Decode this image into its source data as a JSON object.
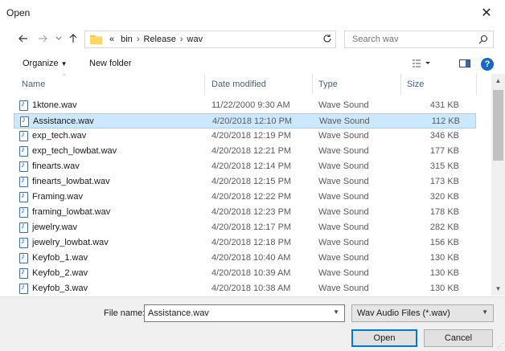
{
  "window": {
    "title": "Open",
    "close_glyph": "✕"
  },
  "nav": {
    "path": [
      "«",
      "bin",
      "Release",
      "wav"
    ],
    "search_placeholder": "Search wav"
  },
  "toolbar": {
    "organize": "Organize",
    "new_folder": "New folder"
  },
  "columns": {
    "name": "Name",
    "date": "Date modified",
    "type": "Type",
    "size": "Size"
  },
  "files": [
    {
      "name": "1ktone.wav",
      "date": "11/22/2000 9:30 AM",
      "type": "Wave Sound",
      "size": "431 KB",
      "selected": false
    },
    {
      "name": "Assistance.wav",
      "date": "4/20/2018 12:10 PM",
      "type": "Wave Sound",
      "size": "112 KB",
      "selected": true
    },
    {
      "name": "exp_tech.wav",
      "date": "4/20/2018 12:19 PM",
      "type": "Wave Sound",
      "size": "346 KB",
      "selected": false
    },
    {
      "name": "exp_tech_lowbat.wav",
      "date": "4/20/2018 12:21 PM",
      "type": "Wave Sound",
      "size": "177 KB",
      "selected": false
    },
    {
      "name": "finearts.wav",
      "date": "4/20/2018 12:14 PM",
      "type": "Wave Sound",
      "size": "315 KB",
      "selected": false
    },
    {
      "name": "finearts_lowbat.wav",
      "date": "4/20/2018 12:15 PM",
      "type": "Wave Sound",
      "size": "173 KB",
      "selected": false
    },
    {
      "name": "Framing.wav",
      "date": "4/20/2018 12:22 PM",
      "type": "Wave Sound",
      "size": "320 KB",
      "selected": false
    },
    {
      "name": "framing_lowbat.wav",
      "date": "4/20/2018 12:23 PM",
      "type": "Wave Sound",
      "size": "178 KB",
      "selected": false
    },
    {
      "name": "jewelry.wav",
      "date": "4/20/2018 12:17 PM",
      "type": "Wave Sound",
      "size": "282 KB",
      "selected": false
    },
    {
      "name": "jewelry_lowbat.wav",
      "date": "4/20/2018 12:18 PM",
      "type": "Wave Sound",
      "size": "156 KB",
      "selected": false
    },
    {
      "name": "Keyfob_1.wav",
      "date": "4/20/2018 10:40 AM",
      "type": "Wave Sound",
      "size": "130 KB",
      "selected": false
    },
    {
      "name": "Keyfob_2.wav",
      "date": "4/20/2018 10:39 AM",
      "type": "Wave Sound",
      "size": "130 KB",
      "selected": false
    },
    {
      "name": "Keyfob_3.wav",
      "date": "4/20/2018 10:38 AM",
      "type": "Wave Sound",
      "size": "130 KB",
      "selected": false
    }
  ],
  "bottom": {
    "file_name_label": "File name:",
    "file_name_value": "Assistance.wav",
    "filter": "Wav Audio Files (*.wav)",
    "open_label": "Open",
    "cancel_label": "Cancel"
  },
  "colors": {
    "selection": "#cce8ff",
    "selection_border": "#99d1ff",
    "accent": "#0078d7",
    "folder": "#f5c542"
  }
}
